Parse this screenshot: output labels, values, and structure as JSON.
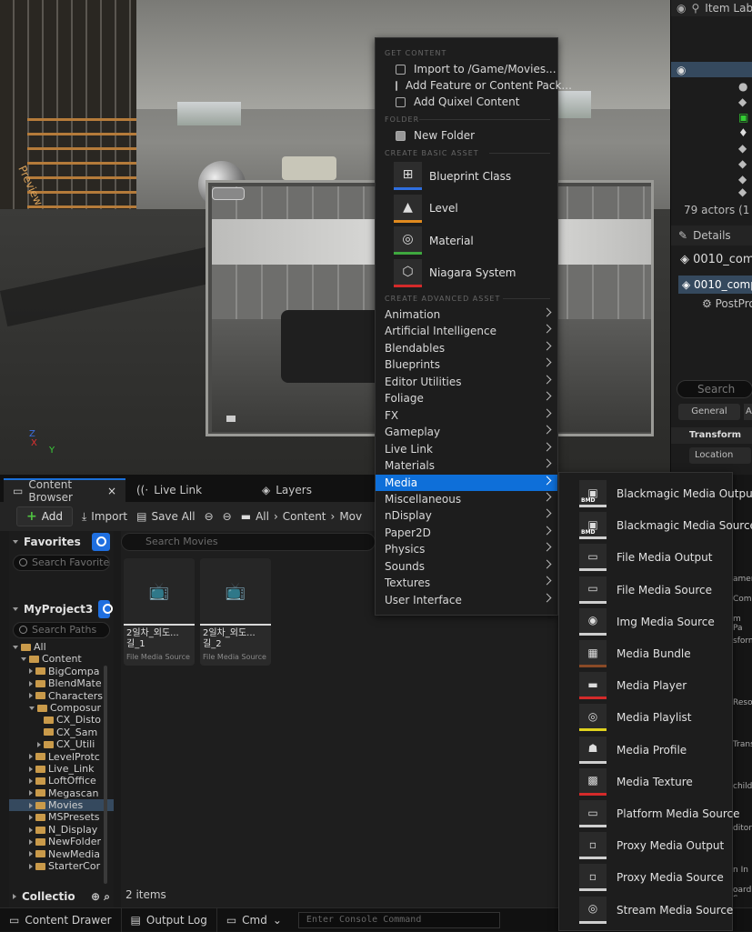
{
  "viewport": {
    "preview_text": "Preview",
    "axis": {
      "x": "X",
      "y": "Y",
      "z": "Z"
    }
  },
  "outliner": {
    "header": "Item Lab",
    "actor_count": "79 actors (1 sel",
    "details_tab": "Details",
    "comp1": "0010_com",
    "comp2": "0010_comp",
    "child": "PostPro",
    "search": "Search",
    "general": "General",
    "general2": "A",
    "transform": "Transform",
    "location": "Location",
    "side_text": [
      "amer",
      "Comp",
      "m Pa",
      "sform",
      "Resolu",
      "Trans",
      "child",
      "ditor",
      "n In",
      "oard S"
    ]
  },
  "tabs": [
    {
      "label": "Content Browser",
      "close": "×"
    },
    {
      "label": "Live Link"
    },
    {
      "label": "Layers"
    }
  ],
  "toolbar": {
    "add": "Add",
    "import": "Import",
    "save_all": "Save All",
    "breadcrumb": [
      "All",
      "Content",
      "Mov"
    ]
  },
  "sidebar": {
    "favorites": "Favorites",
    "fav_search": "Search Favorite",
    "project": "MyProject3",
    "path_search": "Search Paths",
    "collections": "Collectio"
  },
  "tree": [
    {
      "label": "All",
      "depth": 0,
      "open": true,
      "sel": false
    },
    {
      "label": "Content",
      "depth": 1,
      "open": true
    },
    {
      "label": "BigCompa",
      "depth": 2
    },
    {
      "label": "BlendMate",
      "depth": 2
    },
    {
      "label": "Characters",
      "depth": 2
    },
    {
      "label": "Composur",
      "depth": 2,
      "open": true
    },
    {
      "label": "CX_Disto",
      "depth": 3
    },
    {
      "label": "CX_Sam",
      "depth": 3
    },
    {
      "label": "CX_Utili",
      "depth": 3
    },
    {
      "label": "LevelProtc",
      "depth": 2
    },
    {
      "label": "Live_Link",
      "depth": 2
    },
    {
      "label": "LoftOffice",
      "depth": 2
    },
    {
      "label": "Megascan",
      "depth": 2
    },
    {
      "label": "Movies",
      "depth": 2,
      "sel": true
    },
    {
      "label": "MSPresets",
      "depth": 2
    },
    {
      "label": "N_Display",
      "depth": 2
    },
    {
      "label": "NewFolder",
      "depth": 2
    },
    {
      "label": "NewMedia",
      "depth": 2
    },
    {
      "label": "StarterCor",
      "depth": 2
    }
  ],
  "assets": {
    "search": "Search Movies",
    "count": "2 items",
    "items": [
      {
        "name": "2일차_외도...\n길_1",
        "type": "File Media Source"
      },
      {
        "name": "2일차_외도...\n길_2",
        "type": "File Media Source"
      }
    ]
  },
  "statusbar": {
    "drawer": "Content Drawer",
    "output": "Output Log",
    "cmd": "Cmd",
    "console_placeholder": "Enter Console Command"
  },
  "menu": {
    "get_content": "GET CONTENT",
    "import": "Import to /Game/Movies...",
    "add_feature": "Add Feature or Content Pack...",
    "quixel": "Add Quixel Content",
    "folder_h": "FOLDER",
    "new_folder": "New Folder",
    "basic_h": "CREATE BASIC ASSET",
    "basic": [
      {
        "label": "Blueprint Class",
        "color": "#2f6fe0"
      },
      {
        "label": "Level",
        "color": "#e08a1e"
      },
      {
        "label": "Material",
        "color": "#3ea83e"
      },
      {
        "label": "Niagara System",
        "color": "#d42a2a"
      }
    ],
    "advanced_h": "CREATE ADVANCED ASSET",
    "advanced": [
      "Animation",
      "Artificial Intelligence",
      "Blendables",
      "Blueprints",
      "Editor Utilities",
      "Foliage",
      "FX",
      "Gameplay",
      "Live Link",
      "Materials",
      "Media",
      "Miscellaneous",
      "nDisplay",
      "Paper2D",
      "Physics",
      "Sounds",
      "Textures",
      "User Interface"
    ],
    "highlighted": "Media"
  },
  "submenu": [
    {
      "label": "Blackmagic Media Output",
      "badge": "BMD",
      "color": "#cfcfcf"
    },
    {
      "label": "Blackmagic Media Source",
      "badge": "BMD",
      "color": "#cfcfcf"
    },
    {
      "label": "File Media Output",
      "color": "#cfcfcf"
    },
    {
      "label": "File Media Source",
      "color": "#cfcfcf"
    },
    {
      "label": "Img Media Source",
      "color": "#cfcfcf"
    },
    {
      "label": "Media Bundle",
      "color": "#8a4a26"
    },
    {
      "label": "Media Player",
      "color": "#d42a2a"
    },
    {
      "label": "Media Playlist",
      "color": "#e0d21e"
    },
    {
      "label": "Media Profile",
      "color": "#cfcfcf"
    },
    {
      "label": "Media Texture",
      "color": "#d42a2a"
    },
    {
      "label": "Platform Media Source",
      "color": "#cfcfcf"
    },
    {
      "label": "Proxy Media Output",
      "color": "#cfcfcf"
    },
    {
      "label": "Proxy Media Source",
      "color": "#cfcfcf"
    },
    {
      "label": "Stream Media Source",
      "color": "#cfcfcf"
    }
  ]
}
